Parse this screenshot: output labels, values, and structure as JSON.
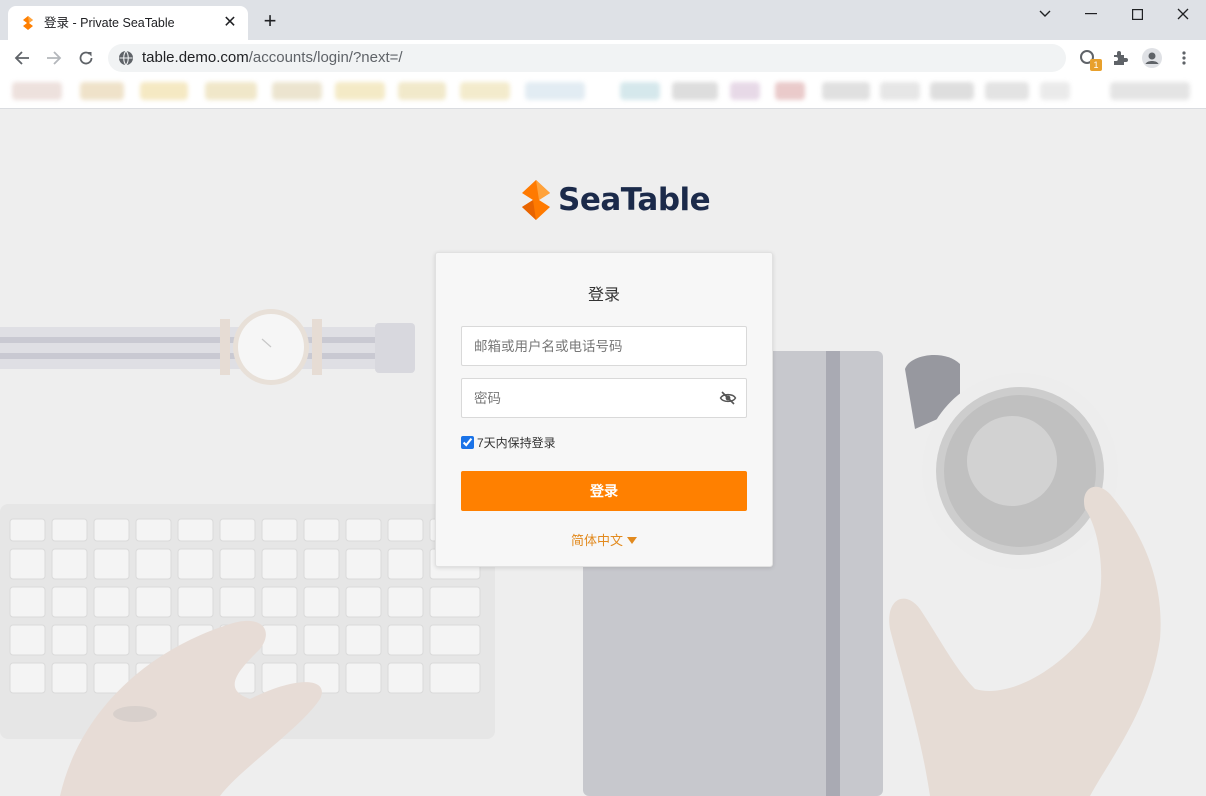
{
  "browser": {
    "tab_title": "登录 - Private SeaTable",
    "new_tab_icon": "+",
    "close_tab_icon": "✕",
    "url_domain": "table.demo.com",
    "url_path": "/accounts/login/?next=/",
    "extension_badge": "1"
  },
  "brand": {
    "name": "SeaTable",
    "color": "#ff8000",
    "text_color": "#1b2a4a"
  },
  "login": {
    "title": "登录",
    "username_placeholder": "邮箱或用户名或电话号码",
    "password_placeholder": "密码",
    "remember_label": "7天内保持登录",
    "remember_checked": true,
    "submit_label": "登录",
    "language_label": "简体中文"
  }
}
